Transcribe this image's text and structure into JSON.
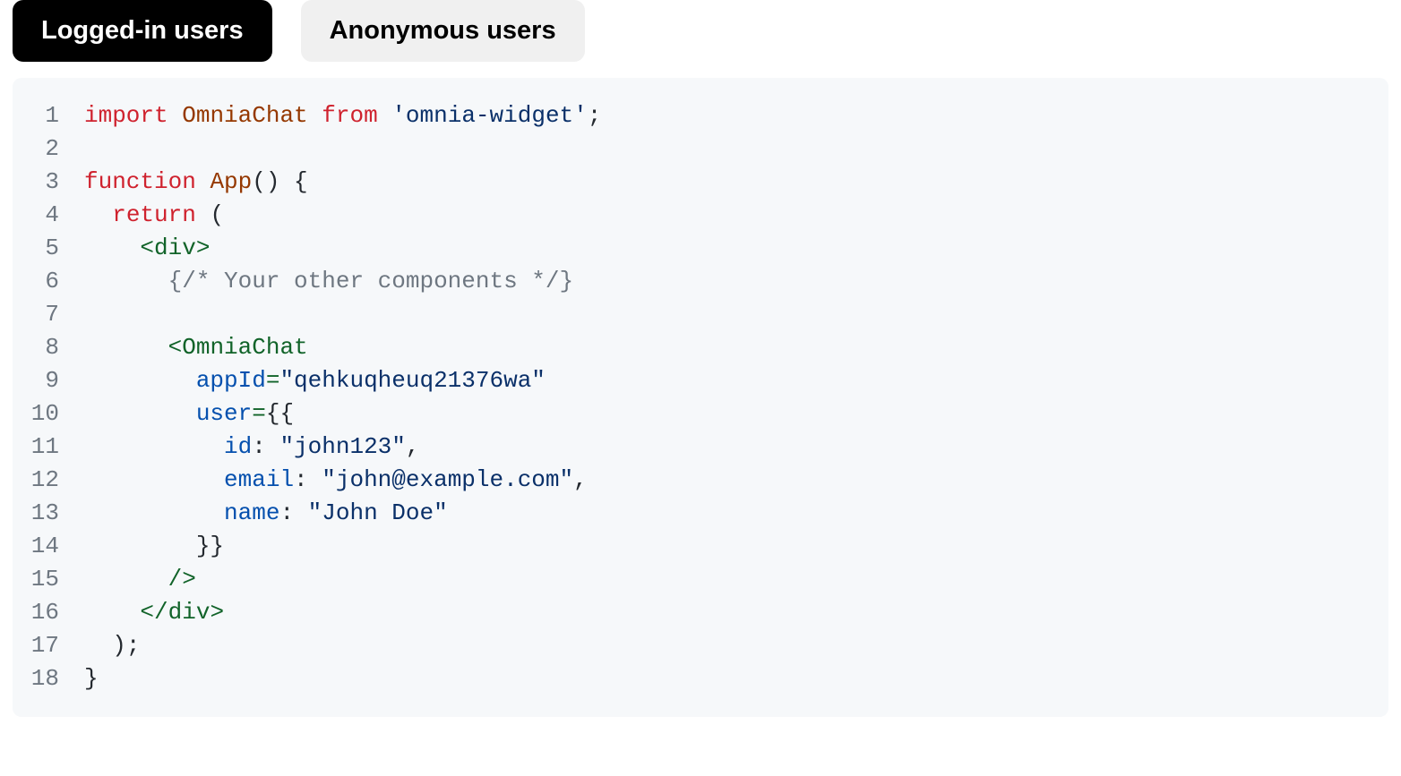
{
  "tabs": {
    "active": "Logged-in users",
    "inactive": "Anonymous users"
  },
  "code": {
    "line1": {
      "kw_import": "import",
      "type": "OmniaChat",
      "kw_from": "from",
      "pkg": "'omnia-widget'",
      "semi": ";"
    },
    "line3": {
      "kw_function": "function",
      "name": "App",
      "parens": "() {"
    },
    "line4": {
      "indent": "  ",
      "kw_return": "return",
      "open": " ("
    },
    "line5": {
      "indent": "    ",
      "open": "<",
      "tag": "div",
      "close": ">"
    },
    "line6": {
      "indent": "      ",
      "comment": "{/* Your other components */}"
    },
    "line8": {
      "indent": "      ",
      "open": "<",
      "tag": "OmniaChat"
    },
    "line9": {
      "indent": "        ",
      "attr": "appId",
      "eq": "=",
      "val": "\"qehkuqheuq21376wa\""
    },
    "line10": {
      "indent": "        ",
      "attr": "user",
      "eq": "=",
      "braces": "{{"
    },
    "line11": {
      "indent": "          ",
      "key": "id",
      "colon": ": ",
      "val": "\"john123\"",
      "comma": ","
    },
    "line12": {
      "indent": "          ",
      "key": "email",
      "colon": ": ",
      "val": "\"john@example.com\"",
      "comma": ","
    },
    "line13": {
      "indent": "          ",
      "key": "name",
      "colon": ": ",
      "val": "\"John Doe\""
    },
    "line14": {
      "indent": "        ",
      "braces": "}}"
    },
    "line15": {
      "indent": "      ",
      "close": "/>"
    },
    "line16": {
      "indent": "    ",
      "open": "</",
      "tag": "div",
      "close": ">"
    },
    "line17": {
      "indent": "  ",
      "close": ");"
    },
    "line18": {
      "close": "}"
    },
    "linenos": {
      "l1": "1",
      "l2": "2",
      "l3": "3",
      "l4": "4",
      "l5": "5",
      "l6": "6",
      "l7": "7",
      "l8": "8",
      "l9": "9",
      "l10": "10",
      "l11": "11",
      "l12": "12",
      "l13": "13",
      "l14": "14",
      "l15": "15",
      "l16": "16",
      "l17": "17",
      "l18": "18"
    }
  }
}
